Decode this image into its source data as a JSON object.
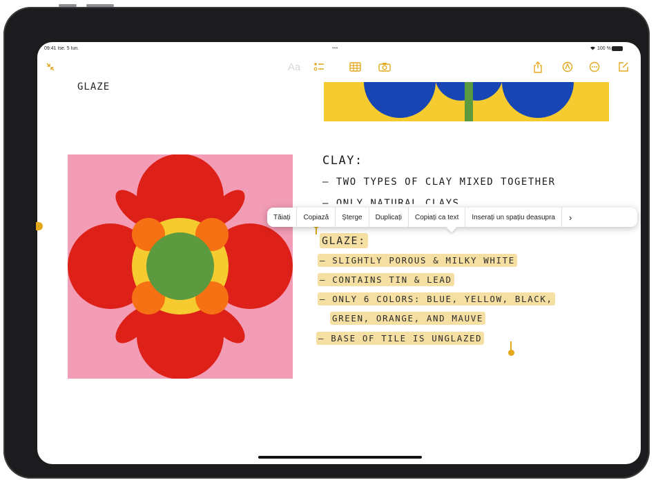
{
  "status_bar": {
    "time_date": "09:41 Ise. 5 Iun.",
    "dots": "•••",
    "battery_text": "100 %"
  },
  "toolbar": {
    "format_label": "Aa"
  },
  "note": {
    "title": "GLAZE",
    "clay_heading": "CLAY:",
    "clay_lines": [
      "— TWO TYPES OF CLAY MIXED TOGETHER",
      "— ONLY NATURAL CLAYS"
    ],
    "glaze_heading": "GLAZE:",
    "glaze_lines": [
      "— SLIGHTLY POROUS & MILKY WHITE",
      "— CONTAINS TIN & LEAD",
      "— ONLY 6 COLORS: BLUE, YELLOW, BLACK,",
      "GREEN, ORANGE, AND MAUVE",
      "— BASE OF TILE IS UNGLAZED"
    ]
  },
  "context_menu": {
    "items": [
      "Tăiați",
      "Copiază",
      "Șterge",
      "Duplicați",
      "Copiați ca text",
      "Inserați un spațiu deasupra"
    ],
    "more_glyph": "›"
  },
  "colors": {
    "accent": "#e3a71c",
    "tile_pink": "#f29cb5",
    "petal_red": "#dd2118",
    "orange": "#f57113",
    "yellow": "#f6cb2f",
    "green": "#5b9a3e",
    "blue": "#1746b4",
    "highlight": "#f5dfa2"
  }
}
